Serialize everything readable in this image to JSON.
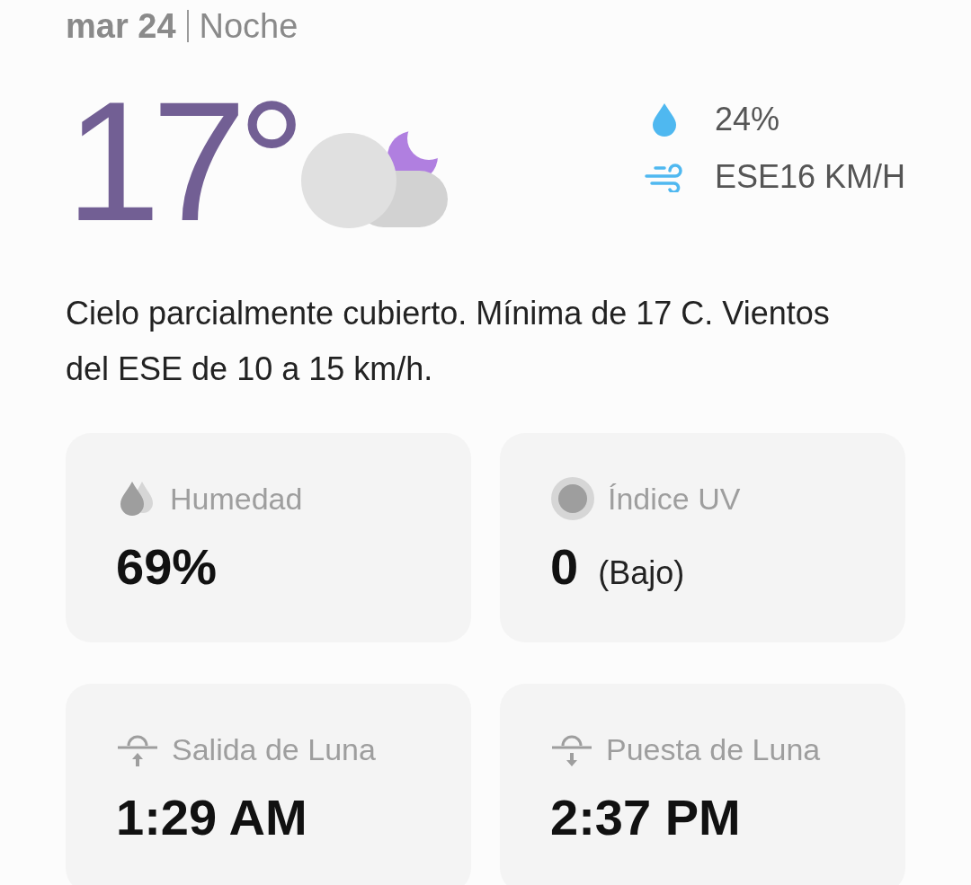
{
  "header": {
    "date": "mar 24",
    "period": "Noche"
  },
  "current": {
    "temperature": "17°",
    "precipitation": "24%",
    "wind": "ESE16 KM/H"
  },
  "description": "Cielo parcialmente cubierto. Mínima de 17 C. Vientos del ESE de 10 a 15 km/h.",
  "cards": [
    {
      "kind": "humidity",
      "label": "Humedad",
      "value": "69%"
    },
    {
      "kind": "uv",
      "label": "Índice UV",
      "value": "0",
      "note": "(Bajo)"
    },
    {
      "kind": "moonrise",
      "label": "Salida de Luna",
      "value": "1:29 AM"
    },
    {
      "kind": "moonset",
      "label": "Puesta de Luna",
      "value": "2:37 PM"
    }
  ]
}
